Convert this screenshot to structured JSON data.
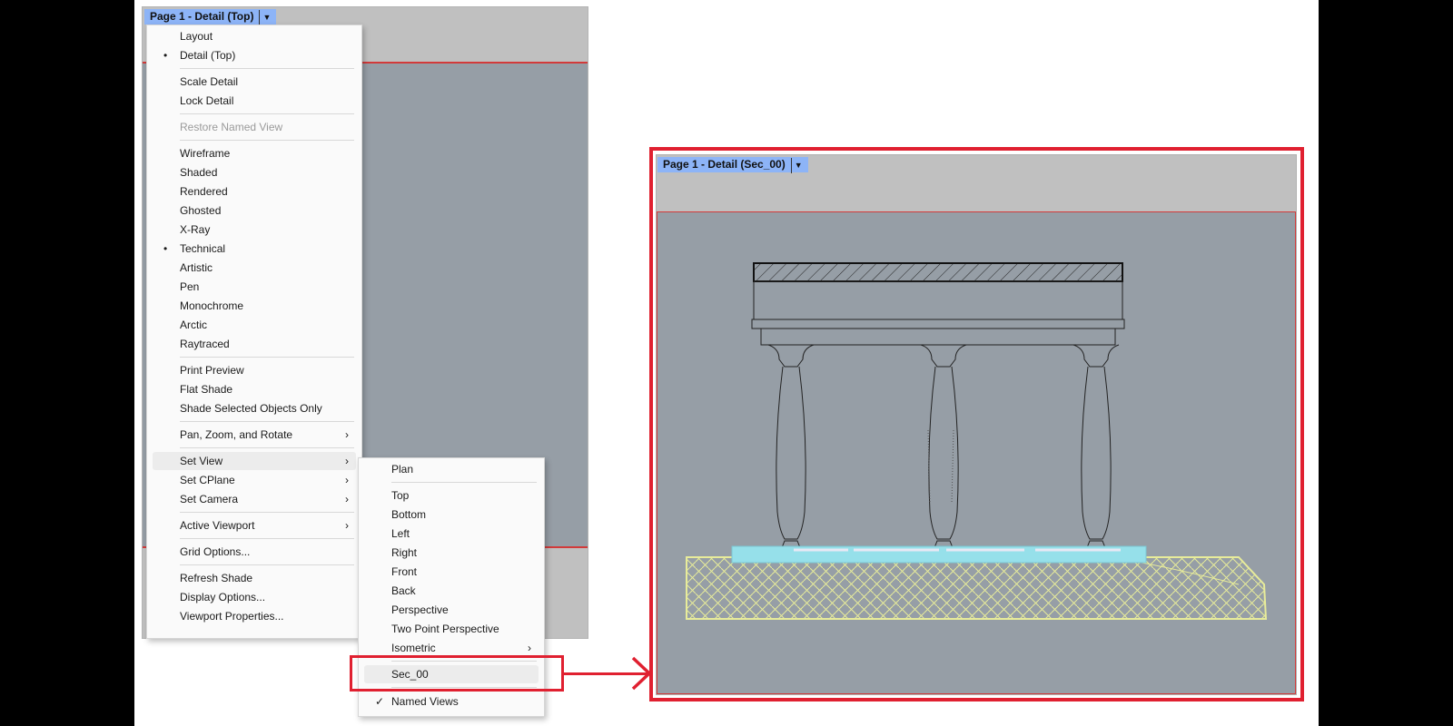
{
  "left_viewport": {
    "tab_title": "Page 1 - Detail (Top)"
  },
  "right_viewport": {
    "tab_title": "Page 1 - Detail (Sec_00)"
  },
  "context_menu": {
    "items": [
      {
        "label": "Layout"
      },
      {
        "label": "Detail (Top)",
        "bullet": "•"
      },
      {
        "label": "Scale Detail"
      },
      {
        "label": "Lock Detail"
      },
      {
        "label": "Restore Named View"
      },
      {
        "label": "Wireframe"
      },
      {
        "label": "Shaded"
      },
      {
        "label": "Rendered"
      },
      {
        "label": "Ghosted"
      },
      {
        "label": "X-Ray"
      },
      {
        "label": "Technical",
        "bullet": "•"
      },
      {
        "label": "Artistic"
      },
      {
        "label": "Pen"
      },
      {
        "label": "Monochrome"
      },
      {
        "label": "Arctic"
      },
      {
        "label": "Raytraced"
      },
      {
        "label": "Print Preview"
      },
      {
        "label": "Flat Shade"
      },
      {
        "label": "Shade Selected Objects Only"
      },
      {
        "label": "Pan, Zoom, and Rotate"
      },
      {
        "label": "Set View"
      },
      {
        "label": "Set CPlane"
      },
      {
        "label": "Set Camera"
      },
      {
        "label": "Active Viewport"
      },
      {
        "label": "Grid Options..."
      },
      {
        "label": "Refresh Shade"
      },
      {
        "label": "Display Options..."
      },
      {
        "label": "Viewport Properties..."
      }
    ],
    "submenu_arrow": "›"
  },
  "set_view_submenu": {
    "items": [
      {
        "label": "Plan"
      },
      {
        "label": "Top"
      },
      {
        "label": "Bottom"
      },
      {
        "label": "Left"
      },
      {
        "label": "Right"
      },
      {
        "label": "Front"
      },
      {
        "label": "Back"
      },
      {
        "label": "Perspective"
      },
      {
        "label": "Two Point Perspective"
      },
      {
        "label": "Isometric"
      },
      {
        "label": "Sec_00"
      },
      {
        "label": "Named Views",
        "check": "✓"
      }
    ]
  },
  "colors": {
    "highlight_red": "#e02030",
    "tab_blue": "#8db4f7",
    "viewport_gray": "#969ea6",
    "ground_hatch": "#e8ec9a",
    "base_cyan": "#96e0ea"
  },
  "icons": {
    "dropdown": "chevron-down-icon",
    "submenu": "chevron-right-icon",
    "checked": "check-icon",
    "active": "bullet-icon"
  }
}
